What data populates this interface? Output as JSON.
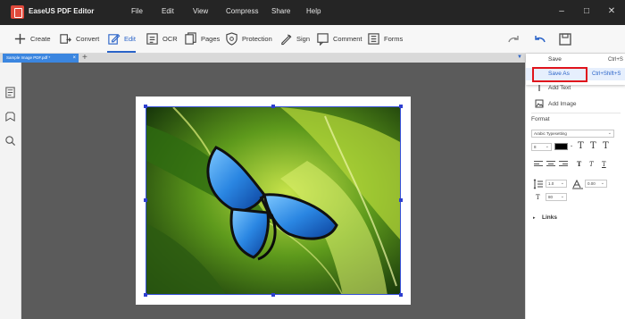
{
  "titlebar": {
    "app_title": "EaseUS PDF Editor",
    "menus": [
      "File",
      "Edit",
      "View",
      "Compress",
      "Share",
      "Help"
    ]
  },
  "toolbar": {
    "tools": [
      {
        "label": "Create",
        "icon": "create-icon"
      },
      {
        "label": "Convert",
        "icon": "convert-icon"
      },
      {
        "label": "Edit",
        "icon": "edit-icon",
        "active": true
      },
      {
        "label": "OCR",
        "icon": "ocr-icon"
      },
      {
        "label": "Pages",
        "icon": "pages-icon"
      },
      {
        "label": "Protection",
        "icon": "protection-icon"
      },
      {
        "label": "Sign",
        "icon": "sign-icon"
      },
      {
        "label": "Comment",
        "icon": "comment-icon"
      },
      {
        "label": "Forms",
        "icon": "forms-icon"
      }
    ]
  },
  "tabs": {
    "active_tab": "Sample Image PDF.pdf *",
    "close": "×",
    "add": "+"
  },
  "save_menu": {
    "items": [
      {
        "label": "Save",
        "shortcut": "Ctrl+S"
      },
      {
        "label": "Save As",
        "shortcut": "Ctrl+Shift+S"
      }
    ]
  },
  "right_panel": {
    "add_text": "Add Text",
    "add_image": "Add Image",
    "format_title": "Format",
    "font_name": "Arabic Typesetting",
    "font_size": "8",
    "line_spacing": "1.0",
    "char_spacing": "0.00",
    "scale": "80",
    "links_title": "Links"
  },
  "colors": {
    "accent": "#2a63c8",
    "title_bar": "#252525",
    "highlight_box": "#e0141c",
    "text_color_swatch": "#000000"
  }
}
